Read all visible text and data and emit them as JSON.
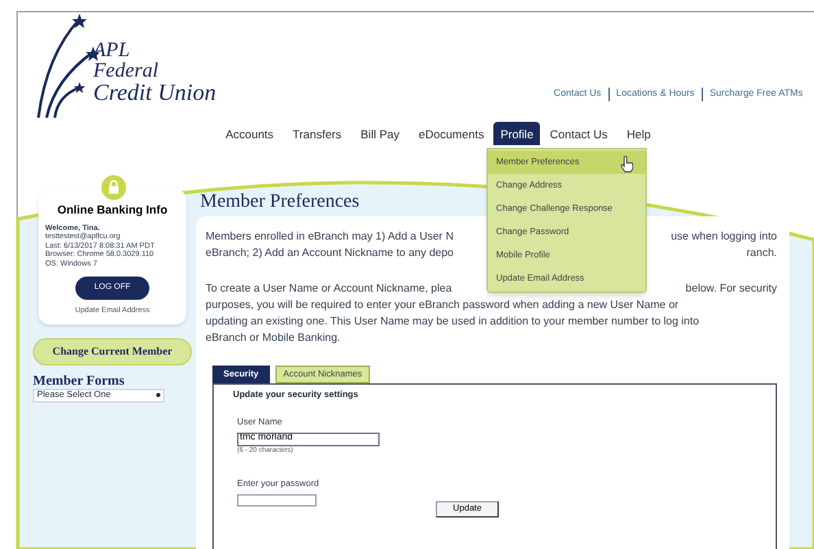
{
  "logo": {
    "lines": [
      "APL",
      "Federal",
      "Credit Union"
    ]
  },
  "top_links": [
    "Contact Us",
    "Locations & Hours",
    "Surcharge Free ATMs"
  ],
  "nav": [
    {
      "label": "Accounts",
      "selected": false
    },
    {
      "label": "Transfers",
      "selected": false
    },
    {
      "label": "Bill Pay",
      "selected": false
    },
    {
      "label": "eDocuments",
      "selected": false
    },
    {
      "label": "Profile",
      "selected": true
    },
    {
      "label": "Contact Us",
      "selected": false
    },
    {
      "label": "Help",
      "selected": false
    }
  ],
  "profile_menu": [
    {
      "label": "Member Preferences",
      "selected": true
    },
    {
      "label": "Change Address",
      "selected": false
    },
    {
      "label": "Change Challenge Response",
      "selected": false
    },
    {
      "label": "Change Password",
      "selected": false
    },
    {
      "label": "Mobile Profile",
      "selected": false
    },
    {
      "label": "Update Email Address",
      "selected": false
    }
  ],
  "banking_info": {
    "title": "Online Banking Info",
    "details": [
      "Welcome, Tina.",
      "testtestest@aplfcu.org",
      "Last: 6/13/2017 8:08:31 AM PDT",
      "Browser: Chrome 58.0.3029.110",
      "OS: Windows 7"
    ],
    "button": "LOG OFF",
    "link": "Update Email Address"
  },
  "change_member_button": "Change Current Member",
  "member_forms": {
    "title": "Member Forms",
    "select": "Please Select One"
  },
  "page_title": "Member Preferences",
  "paragraphs": [
    [
      {
        "kind": "split",
        "left": "Members enrolled in eBranch may 1) Add a User N",
        "right": "use when logging into"
      },
      {
        "kind": "split",
        "left": "eBranch; 2) Add an Account Nickname to any depo",
        "right": "ranch."
      }
    ],
    [
      {
        "kind": "split",
        "left": "To create a User Name or Account Nickname, plea",
        "right": "below. For security"
      },
      {
        "kind": "full",
        "text": "purposes, you will be required to enter your eBranch password when adding a new User Name or"
      },
      {
        "kind": "full",
        "text": "updating an existing one. This User Name may be used in addition to your member number to log into"
      },
      {
        "kind": "full",
        "text": "eBranch or Mobile Banking."
      }
    ]
  ],
  "tabs": [
    {
      "label": "Security",
      "selected": true
    },
    {
      "label": "Account Nicknames",
      "selected": false
    }
  ],
  "form": {
    "heading": "Update your security settings",
    "fields": [
      {
        "kind": "text",
        "label": "User Name",
        "value": "tmc morland",
        "hint": "(6 - 20 characters)"
      },
      {
        "kind": "password",
        "label": "Enter your password"
      }
    ],
    "button": "Update"
  }
}
